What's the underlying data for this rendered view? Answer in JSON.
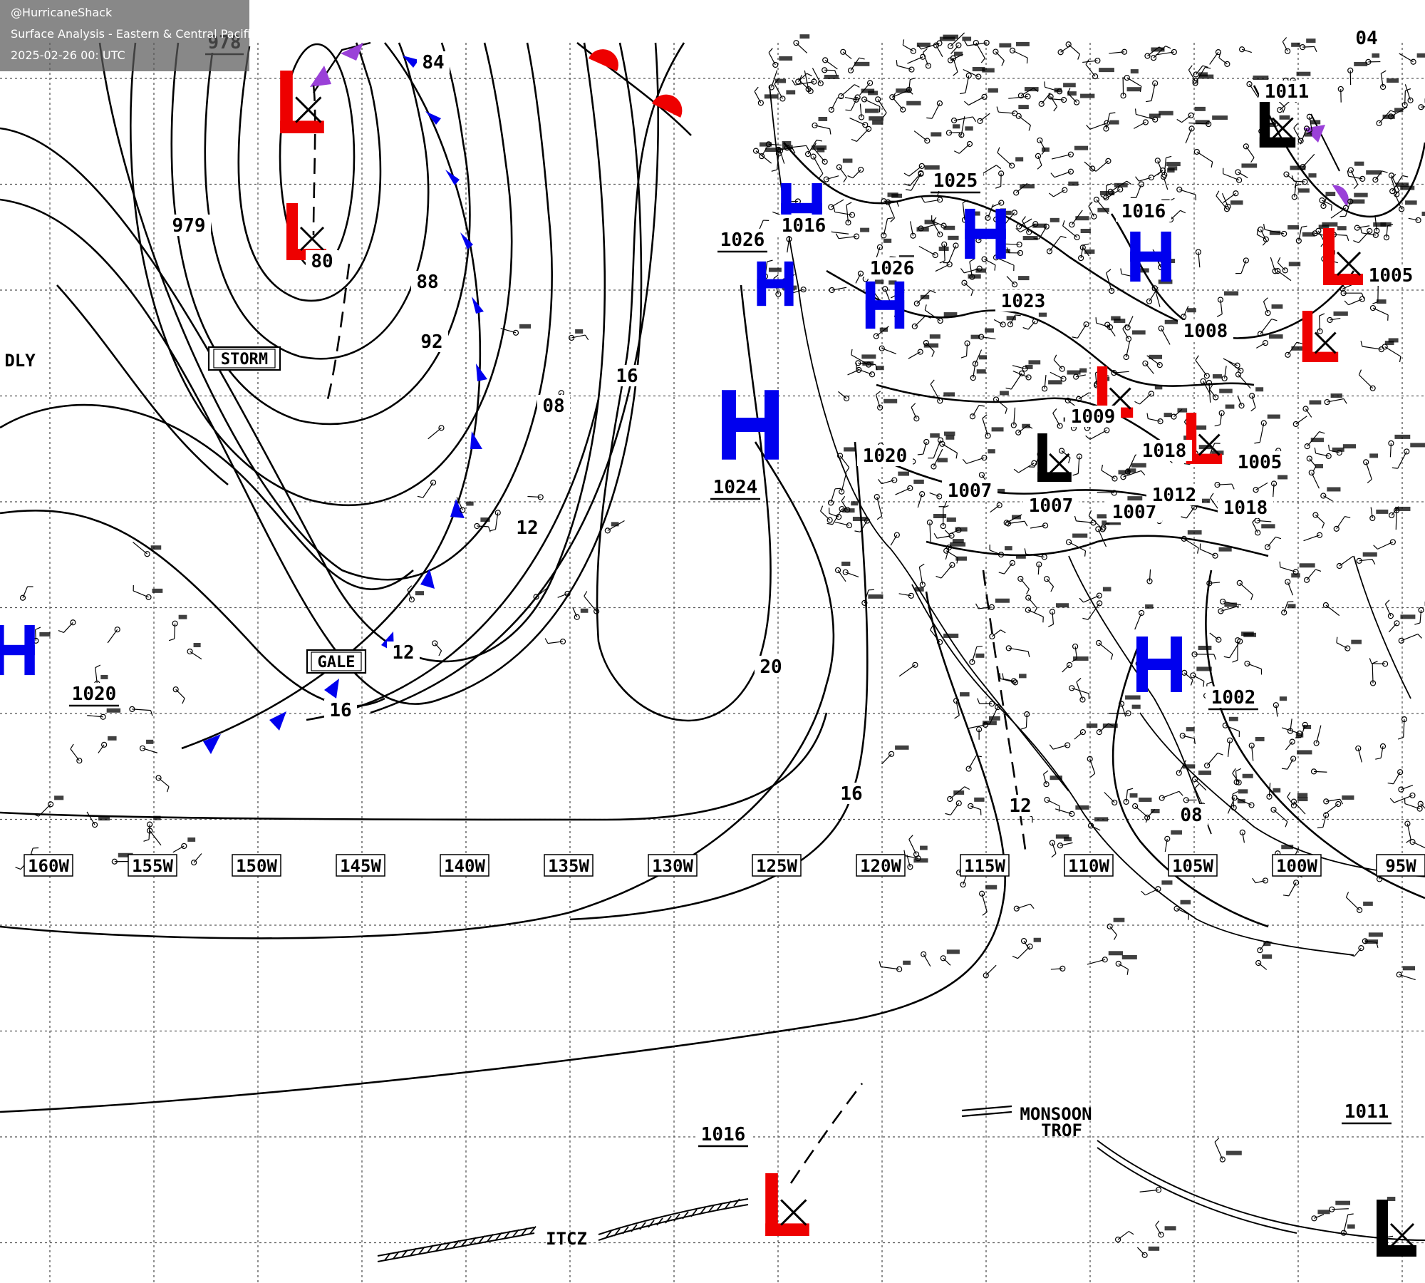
{
  "header": {
    "handle": "@HurricaneShack",
    "title": "Surface Analysis - Eastern & Central Pacific Ocean",
    "timestamp": "2025-02-26 00: UTC"
  },
  "longitude_labels": [
    "160W",
    "155W",
    "150W",
    "145W",
    "140W",
    "135W",
    "130W",
    "125W",
    "120W",
    "115W",
    "110W",
    "105W",
    "100W",
    "95W"
  ],
  "isobar_labels": [
    "978",
    "979",
    "80",
    "84",
    "88",
    "92",
    "08",
    "16",
    "12",
    "12",
    "16",
    "20",
    "16",
    "12",
    "08",
    "1020",
    "1024",
    "1026",
    "1016",
    "1025",
    "1016",
    "1023",
    "1026",
    "1008",
    "1009",
    "1020",
    "1007",
    "1007",
    "1007",
    "1012",
    "1018",
    "1018",
    "1005",
    "1002",
    "1016",
    "1011",
    "1011",
    "1005",
    "04"
  ],
  "pressure_centers": [
    {
      "type": "H",
      "color": "#0000ee"
    },
    {
      "type": "H",
      "color": "#0000ee"
    },
    {
      "type": "H",
      "color": "#0000ee"
    },
    {
      "type": "H",
      "color": "#0000ee"
    },
    {
      "type": "H",
      "color": "#0000ee"
    },
    {
      "type": "H",
      "color": "#0000ee"
    },
    {
      "type": "H",
      "color": "#0000ee"
    },
    {
      "type": "H",
      "color": "#0000ee"
    },
    {
      "type": "L",
      "color": "#ee0000"
    },
    {
      "type": "L",
      "color": "#ee0000"
    },
    {
      "type": "L",
      "color": "#ee0000"
    },
    {
      "type": "L",
      "color": "#ee0000"
    },
    {
      "type": "L",
      "color": "#ee0000"
    },
    {
      "type": "L",
      "color": "#ee0000"
    },
    {
      "type": "L",
      "color": "#ee0000"
    },
    {
      "type": "L",
      "color": "#000000"
    },
    {
      "type": "L",
      "color": "#000000"
    },
    {
      "type": "L",
      "color": "#000000"
    }
  ],
  "warning_boxes": [
    "STORM",
    "GALE"
  ],
  "text_labels": [
    "DLY",
    "MONSOON",
    "TROF",
    "ITCZ"
  ],
  "colors": {
    "high": "#0000ee",
    "low": "#ee0000",
    "cold_front": "#0000ee",
    "warm_front": "#ee0000",
    "occluded_front": "#9a40d8",
    "isobar": "#000000",
    "grid": "#555555"
  }
}
